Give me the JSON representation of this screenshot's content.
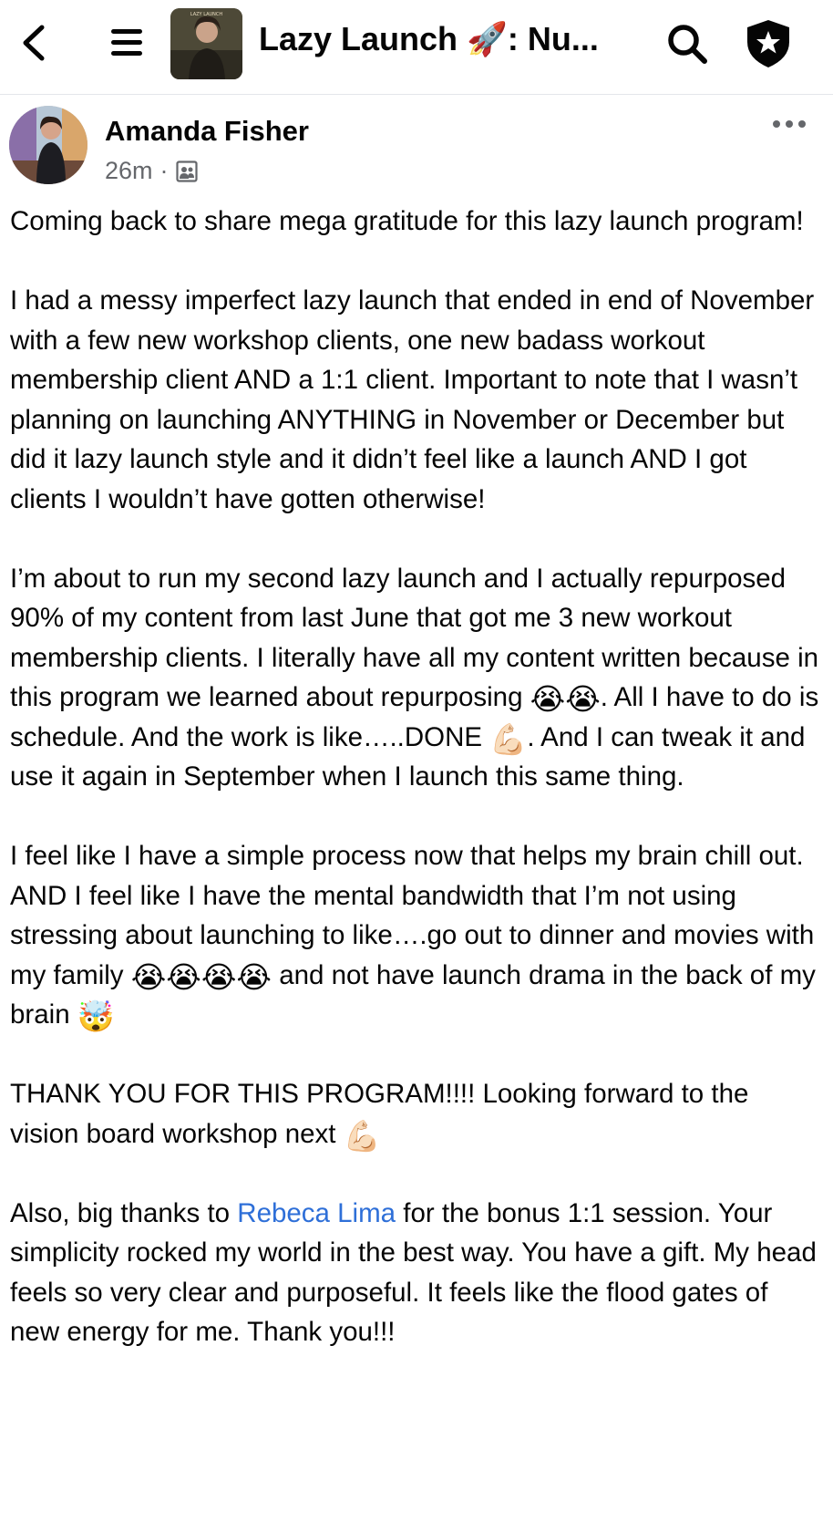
{
  "header": {
    "group_title": "Lazy Launch 🚀: Nu...",
    "group_thumb_caption": "LAZY LAUNCH"
  },
  "post": {
    "author": "Amanda Fisher",
    "time": "26m",
    "separator": "·",
    "paragraphs": {
      "p1": "Coming back to share mega gratitude for this lazy launch program!",
      "p2": "I had a messy imperfect lazy launch that ended in end of November with a few new workshop clients, one new badass workout membership client AND a 1:1 client. Important to note that I wasn’t planning on launching ANYTHING in November or December but did it lazy launch style and it didn’t feel like a launch AND I got clients I wouldn’t have gotten otherwise!",
      "p3a": "I’m about to run my second lazy launch and I actually repurposed 90% of my content from last June that got me 3 new workout membership clients. I literally have all my content written because in this program we learned about repurposing ",
      "p3b": ". All I have to do is schedule. And the work is like…..DONE ",
      "p3c": ". And I can tweak it and use it again in September when I launch this same thing.",
      "p4a": "I feel like I have a simple process now that helps my brain chill out. AND I feel like I have the mental bandwidth that I’m not using stressing about launching to like….go out to dinner and movies with my family ",
      "p4b": " and not have launch drama in the back of my brain ",
      "p5a": "THANK YOU FOR THIS PROGRAM!!!! Looking forward  to the vision board workshop next ",
      "p6a": "Also, big thanks to ",
      "p6_mention": "Rebeca Lima",
      "p6b": " for the bonus 1:1 session. Your simplicity rocked my world in the best way. You have a gift. My head feels so very clear and purposeful. It feels like the flood gates of new energy for me. Thank you!!!"
    },
    "emoji": {
      "crying_pair": "😭😭",
      "muscle": "💪🏻",
      "crying_four": "😭😭😭😭",
      "mind_blown": "🤯",
      "muscle2": "💪🏻"
    }
  },
  "colors": {
    "mention": "#2e6fd8",
    "meta_gray": "#65676b",
    "divider": "#e4e6eb"
  },
  "icons": [
    "back-chevron-icon",
    "hamburger-menu-icon",
    "search-icon",
    "admin-shield-star-icon",
    "more-dots-icon",
    "group-audience-icon"
  ]
}
